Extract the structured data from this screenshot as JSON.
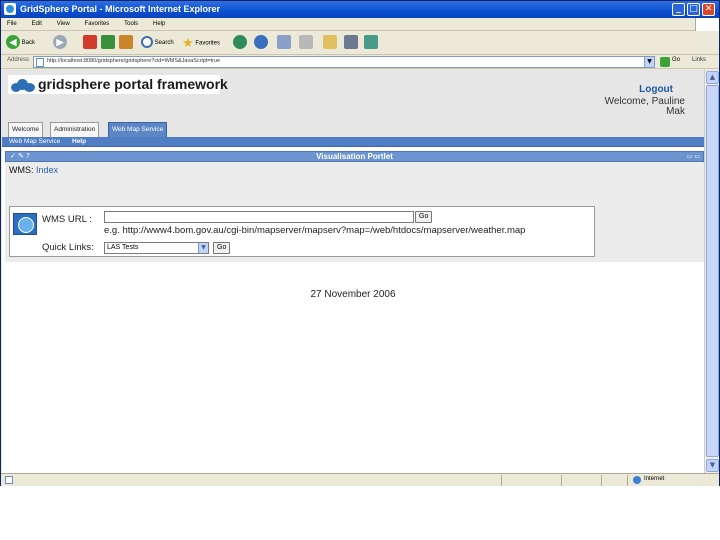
{
  "window": {
    "title": "GridSphere Portal - Microsoft Internet Explorer",
    "min_glyph": "_",
    "max_glyph": "□",
    "close_glyph": "✕"
  },
  "menu": [
    "File",
    "Edit",
    "View",
    "Favorites",
    "Tools",
    "Help"
  ],
  "toolbar": {
    "back": "Back",
    "search": "Search",
    "favorites": "Favorites",
    "back_glyph": "◀",
    "forward_glyph": "▶"
  },
  "address": {
    "label": "Address",
    "url": "http://localhost:8080/gridsphere/gridsphere?cid=WMS&JavaScript=true",
    "go": "Go",
    "links": "Links"
  },
  "portal": {
    "logo": "gridsphere portal framework",
    "logout": "Logout",
    "welcome": "Welcome, Pauline Mak"
  },
  "tabs": [
    "Welcome",
    "Administration",
    "Web Map Service"
  ],
  "subnav": {
    "item": "Web Map Service",
    "help": "Help"
  },
  "portlet": {
    "title": "Visualisation Portlet",
    "left_icons": "✓ ✎ ?",
    "right_icons": "▭ ▭",
    "crumb_prefix": "WMS: ",
    "crumb_link": "Index"
  },
  "form": {
    "wms_label": "WMS URL :",
    "wms_value": "",
    "go": "Go",
    "example": "e.g. http://www4.bom.gov.au/cgi-bin/mapserver/mapserv?map=/web/htdocs/mapserver/weather.map",
    "quick_label": "Quick Links:",
    "quick_selected": "LAS Tests"
  },
  "date": "27 November 2006",
  "status": {
    "zone": "Internet"
  }
}
